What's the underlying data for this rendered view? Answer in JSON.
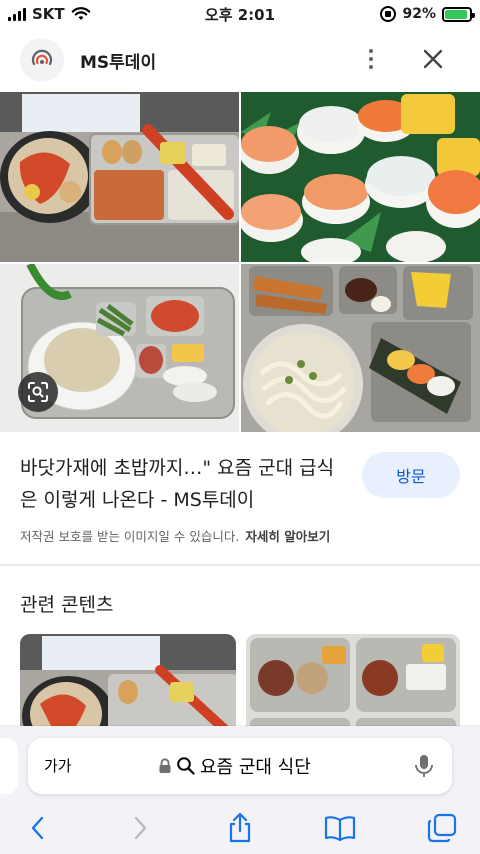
{
  "status_bar": {
    "carrier": "SKT",
    "time": "오후 2:01",
    "battery": "92%",
    "battery_level": 0.92
  },
  "header": {
    "site_name": "MS투데이",
    "logo_icon": "ms-today-logo",
    "more_icon": "more-vertical-icon",
    "close_icon": "close-icon"
  },
  "result": {
    "title": "바닷가재에 초밥까지…\" 요즘 군대 급식은 이렇게 나온다 - MS투데이",
    "visit_label": "방문",
    "copyright_notice": "저작권 보호를 받는 이미지일 수 있습니다.",
    "learn_more": "자세히 알아보기"
  },
  "related": {
    "heading": "관련 콘텐츠"
  },
  "browser": {
    "text_size_label": "가가",
    "url": "요즘 군대 식단",
    "toolbar_icons": [
      "back-icon",
      "forward-icon",
      "share-icon",
      "bookmarks-icon",
      "tabs-icon"
    ]
  },
  "colors": {
    "accent": "#0b57d0",
    "visit_bg": "#e8f0fe",
    "battery_fill": "#34c759",
    "browser_bg": "#f2f2f7"
  }
}
